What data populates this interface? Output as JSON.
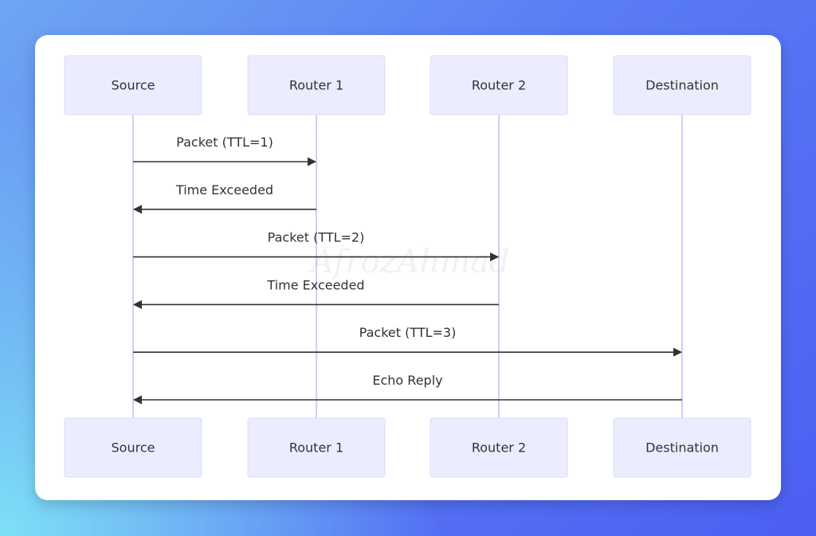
{
  "diagram": {
    "type": "sequence",
    "actors": [
      "Source",
      "Router 1",
      "Router 2",
      "Destination"
    ],
    "messages": [
      {
        "from": 0,
        "to": 1,
        "label": "Packet (TTL=1)"
      },
      {
        "from": 1,
        "to": 0,
        "label": "Time Exceeded"
      },
      {
        "from": 0,
        "to": 2,
        "label": "Packet (TTL=2)"
      },
      {
        "from": 2,
        "to": 0,
        "label": "Time Exceeded"
      },
      {
        "from": 0,
        "to": 3,
        "label": "Packet (TTL=3)"
      },
      {
        "from": 3,
        "to": 0,
        "label": "Echo Reply"
      }
    ],
    "watermark": "AfrozAhmad"
  },
  "colors": {
    "actor_fill": "#ececff",
    "lifeline": "#d3cdf5",
    "arrow": "#333333"
  }
}
